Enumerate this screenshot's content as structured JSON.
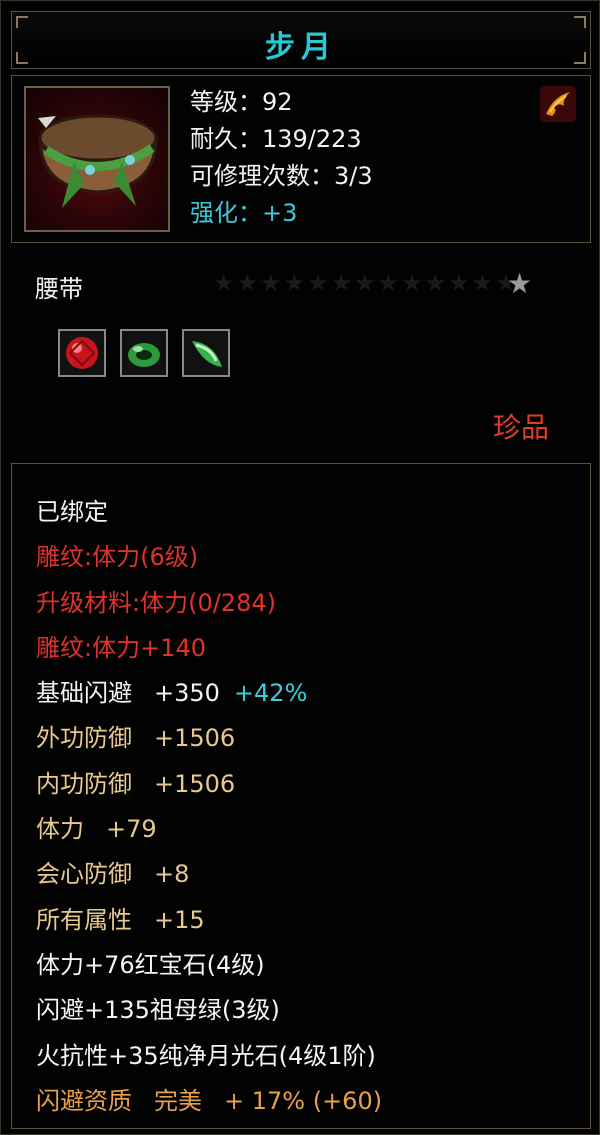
{
  "title": "步月",
  "header": {
    "level": "等级：92",
    "durability": "耐久：139/223",
    "repair": "可修理次数：3/3",
    "enhance": "强化：+3",
    "item_icon": "belt-icon",
    "corner_icon": "flame-feather-icon"
  },
  "type_label": "腰带",
  "stars_empty": "★★★★★★★★★★★★★",
  "star_active": "★",
  "gems": [
    {
      "name": "ruby-gem-icon",
      "color": "#d01c24"
    },
    {
      "name": "emerald-ring-icon",
      "color": "#2c9a3a"
    },
    {
      "name": "jade-shard-icon",
      "color": "#34b44a"
    }
  ],
  "rarity": "珍品",
  "attributes": {
    "bound": "已绑定",
    "engrave": "雕纹:体力(6级)",
    "upgrade": "升级材料:体力(0/284)",
    "engrave_bonus": "雕纹:体力+140",
    "dodge_label": "基础闪避",
    "dodge_value": "+350",
    "dodge_pct": "+42%",
    "ext_def_label": "外功防御",
    "ext_def_value": "+1506",
    "int_def_label": "内功防御",
    "int_def_value": "+1506",
    "vit_label": "体力",
    "vit_value": "+79",
    "crit_def_label": "会心防御",
    "crit_def_value": "+8",
    "all_attr_label": "所有属性",
    "all_attr_value": "+15",
    "gem1": "体力+76红宝石(4级)",
    "gem2": "闪避+135祖母绿(3级)",
    "gem3": "火抗性+35纯净月光石(4级1阶)",
    "quality_label": "闪避资质",
    "quality_grade": "完美",
    "quality_value": "+ 17% (+60)"
  },
  "colors": {
    "title": "#28c9d4",
    "red_text": "#e0322b",
    "tan_text": "#e8c88c",
    "cyan_text": "#37d0e0",
    "rarity": "#e03a2a",
    "border": "#5a5040"
  }
}
